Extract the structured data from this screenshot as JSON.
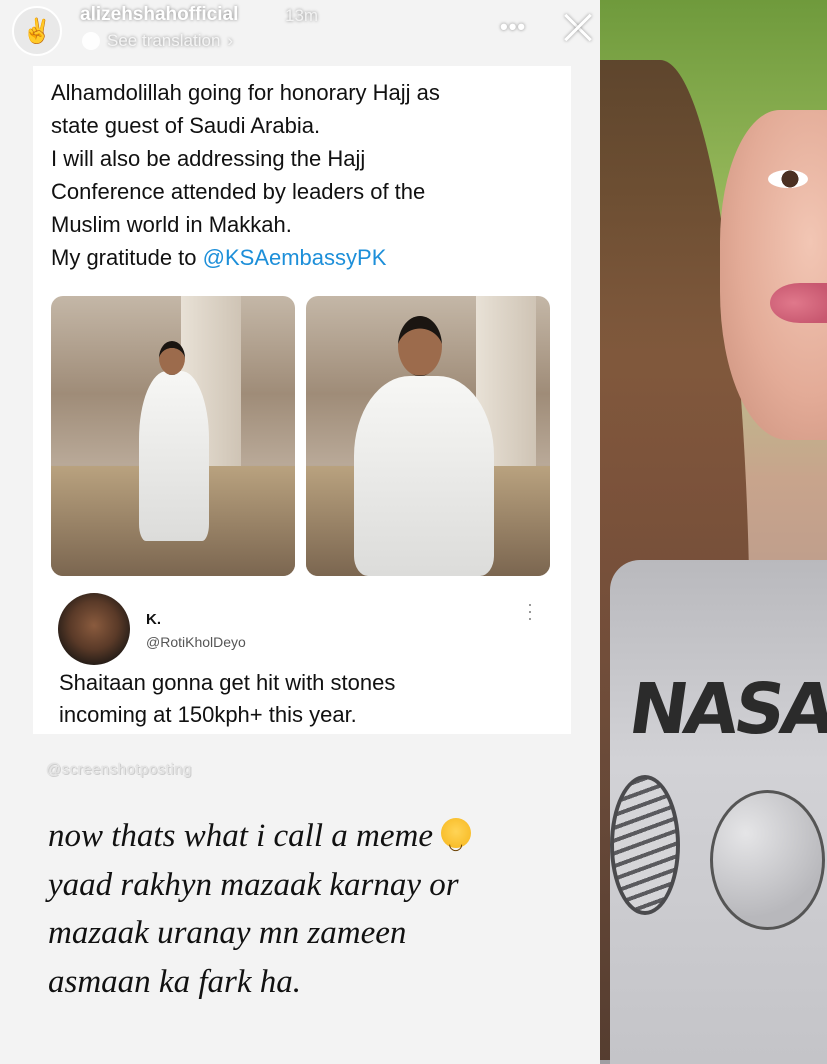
{
  "story": {
    "username": "alizehshahofficial",
    "time": "13m",
    "translation_label": "See translation",
    "more_icon": "more-horizontal-icon",
    "close_icon": "close-icon"
  },
  "tweet": {
    "lines": [
      "Alhamdolillah going for honorary Hajj as",
      "state guest of Saudi Arabia.",
      "I will also be addressing the Hajj",
      "Conference attended by leaders of the",
      "Muslim world in Makkah.",
      "My gratitude to "
    ],
    "mention": "@KSAembassyPK"
  },
  "reply": {
    "name": "K.",
    "handle": "@RotiKholDeyo",
    "text_line1": "Shaitaan gonna get hit with stones",
    "text_line2": "incoming at 150kph+ this year."
  },
  "watermark": "@screenshotposting",
  "caption": {
    "line1": "now thats what i call a meme ",
    "line2": "yaad rakhyn mazaak karnay or",
    "line3": "mazaak uranay mn zameen",
    "line4": "asmaan ka fark ha."
  },
  "side_photo": {
    "shirt_text": "NASA"
  },
  "colors": {
    "mention": "#1d8fd9",
    "background": "#f3f3f3"
  }
}
